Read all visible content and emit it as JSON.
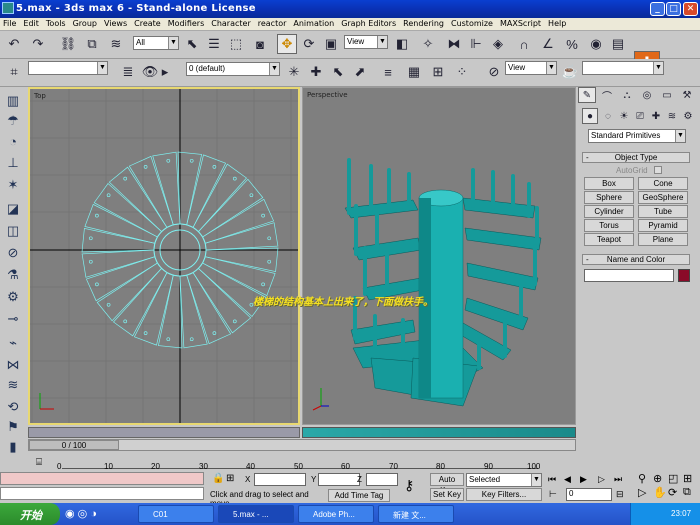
{
  "window": {
    "title": "5.max - 3ds max 6 - Stand-alone License",
    "min": "_",
    "max": "□",
    "close": "✕"
  },
  "menu": [
    "File",
    "Edit",
    "Tools",
    "Group",
    "Views",
    "Create",
    "Modifiers",
    "Character",
    "reactor",
    "Animation",
    "Graph Editors",
    "Rendering",
    "Customize",
    "MAXScript",
    "Help"
  ],
  "toolbar1": {
    "selection_filter": "All",
    "ref_coord": "View"
  },
  "toolbar2": {
    "layer": "0 (default)",
    "view2": "View"
  },
  "viewports": {
    "top": {
      "label": "Top"
    },
    "persp": {
      "label": "Perspective",
      "caption": "楼梯的结构基本上出来了，下面做扶手。"
    }
  },
  "command_panel": {
    "category": "Standard Primitives",
    "rollout1_title": "Object Type",
    "autogrid": "AutoGrid",
    "objects": [
      "Box",
      "Cone",
      "Sphere",
      "GeoSphere",
      "Cylinder",
      "Tube",
      "Torus",
      "Pyramid",
      "Teapot",
      "Plane"
    ],
    "rollout2_title": "Name and Color"
  },
  "timeslider": {
    "label": "0 / 100"
  },
  "ruler": [
    "0",
    "10",
    "20",
    "30",
    "40",
    "50",
    "60",
    "70",
    "80",
    "90",
    "100"
  ],
  "status": {
    "x_label": "X",
    "y_label": "Y",
    "z_label": "Z",
    "prompt": "Click and drag to select and move",
    "add_time_tag": "Add Time Tag",
    "auto_key": "Auto Key",
    "set_key": "Set Key",
    "key_mode": "Selected",
    "key_filters": "Key Filters...",
    "frame": "0"
  },
  "taskbar": {
    "start": "开始",
    "tasks": [
      "C01",
      "5.max - ...",
      "Adobe Ph...",
      "新建 文..."
    ],
    "time": "23:07"
  },
  "colors": {
    "object_color": "#8a0a28",
    "selected_border": "#e8d870",
    "stair": "#159a9a"
  }
}
